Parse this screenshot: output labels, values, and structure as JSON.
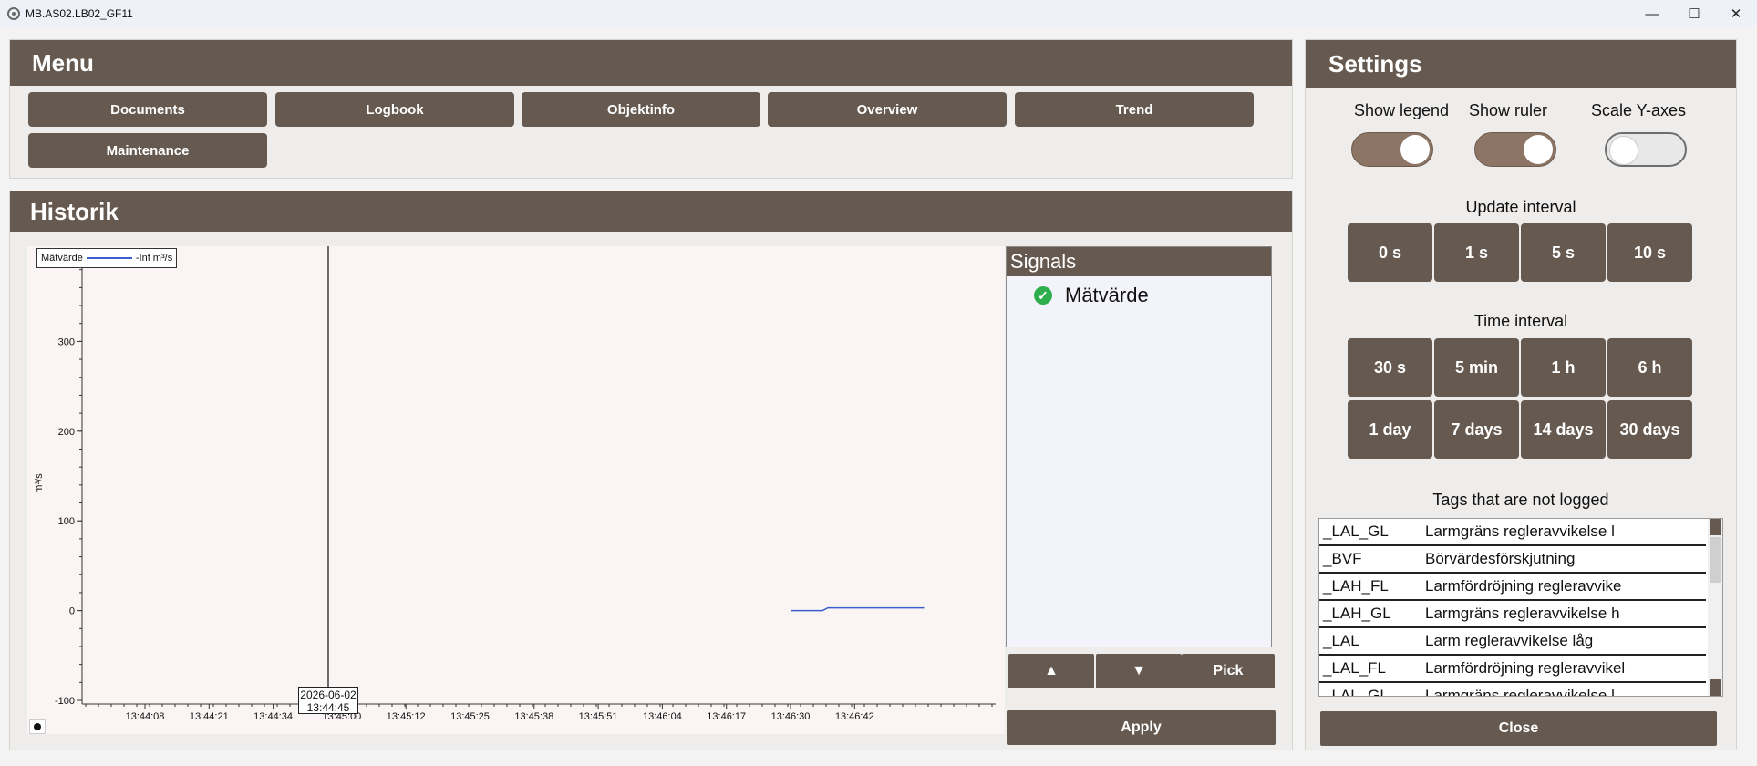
{
  "window": {
    "title": "MB.AS02.LB02_GF11",
    "minimize": "—",
    "maximize": "☐",
    "close": "✕"
  },
  "menu": {
    "title": "Menu",
    "buttons": [
      "Documents",
      "Logbook",
      "Objektinfo",
      "Overview",
      "Trend",
      "Maintenance"
    ]
  },
  "historik": {
    "title": "Historik",
    "legend": {
      "series": "Mätvärde",
      "value": "-Inf m³/s"
    },
    "cursor": {
      "date": "2026-06-02",
      "time": "13:44:45"
    }
  },
  "chart_data": {
    "type": "line",
    "ylabel": "m³/s",
    "xlabel": "",
    "ylim": [
      -100,
      400
    ],
    "yticks": [
      -100,
      0,
      100,
      200,
      300
    ],
    "xticks": [
      "13:44:08",
      "13:44:21",
      "13:44:34",
      "13:45:00",
      "13:45:12",
      "13:45:25",
      "13:45:38",
      "13:45:51",
      "13:46:04",
      "13:46:17",
      "13:46:30",
      "13:46:42"
    ],
    "legend_position": "top-left",
    "series": [
      {
        "name": "Mätvärde",
        "color": "#3b5fcf",
        "x": [
          "13:46:30",
          "13:46:36",
          "13:46:37",
          "13:46:55"
        ],
        "values": [
          0,
          0,
          3,
          3
        ]
      }
    ]
  },
  "signals": {
    "title": "Signals",
    "items": [
      "Mätvärde"
    ],
    "up_label": "▲",
    "down_label": "▼",
    "pick_label": "Pick",
    "apply_label": "Apply"
  },
  "settings": {
    "title": "Settings",
    "toggles": [
      {
        "label": "Show legend",
        "on": true
      },
      {
        "label": "Show ruler",
        "on": true
      },
      {
        "label": "Scale Y-axes",
        "on": false
      }
    ],
    "update_interval_label": "Update interval",
    "update_intervals": [
      "0 s",
      "1 s",
      "5 s",
      "10 s"
    ],
    "time_interval_label": "Time interval",
    "time_intervals": [
      "30 s",
      "5 min",
      "1 h",
      "6 h",
      "1 day",
      "7 days",
      "14 days",
      "30 days"
    ],
    "tags_label": "Tags that are not logged",
    "tags": [
      {
        "code": "_LAL_GL",
        "desc": "Larmgräns regleravvikelse l"
      },
      {
        "code": "_BVF",
        "desc": "Börvärdesförskjutning"
      },
      {
        "code": "_LAH_FL",
        "desc": "Larmfördröjning regleravvike"
      },
      {
        "code": "_LAH_GL",
        "desc": "Larmgräns regleravvikelse h"
      },
      {
        "code": "_LAL",
        "desc": "Larm regleravvikelse låg"
      },
      {
        "code": "_LAL_FL",
        "desc": "Larmfördröjning regleravvikelse låg"
      },
      {
        "code": "_LAL_GL",
        "desc": "Larmgräns regleravvikelse l"
      }
    ],
    "close_label": "Close"
  }
}
